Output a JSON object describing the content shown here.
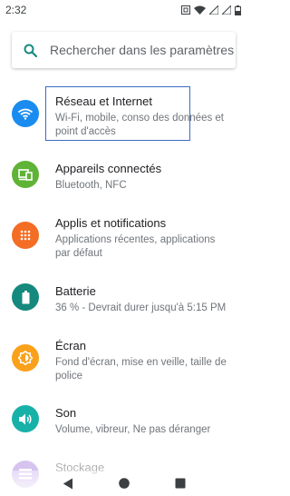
{
  "status": {
    "time": "2:32"
  },
  "search": {
    "placeholder": "Rechercher dans les paramètres"
  },
  "items": [
    {
      "title": "Réseau et Internet",
      "subtitle": "Wi-Fi, mobile, conso des données et point d'accès",
      "icon": "wifi-icon",
      "color": "#1a8cf0"
    },
    {
      "title": "Appareils connectés",
      "subtitle": "Bluetooth, NFC",
      "icon": "devices-icon",
      "color": "#5fb336"
    },
    {
      "title": "Applis et notifications",
      "subtitle": "Applications récentes, applications par défaut",
      "icon": "apps-icon",
      "color": "#f36d24"
    },
    {
      "title": "Batterie",
      "subtitle": "36 % - Devrait durer jusqu'à 5:15 PM",
      "icon": "battery-icon",
      "color": "#15897d"
    },
    {
      "title": "Écran",
      "subtitle": "Fond d'écran, mise en veille, taille de police",
      "icon": "brightness-icon",
      "color": "#f9a11b"
    },
    {
      "title": "Son",
      "subtitle": "Volume, vibreur, Ne pas déranger",
      "icon": "volume-icon",
      "color": "#17b1a8"
    },
    {
      "title": "Stockage",
      "subtitle": "",
      "icon": "storage-icon",
      "color": "#8c5ad2"
    }
  ]
}
